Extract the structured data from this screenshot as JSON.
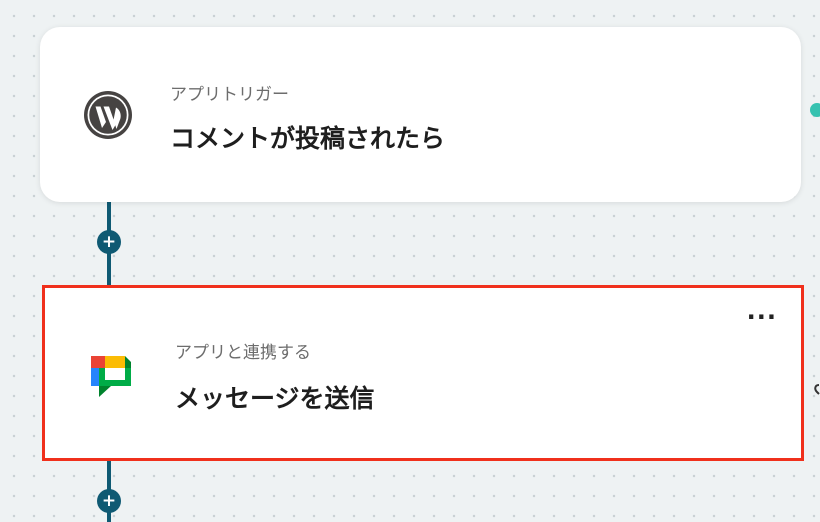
{
  "flow": {
    "steps": [
      {
        "app_icon": "wordpress-icon",
        "subtitle": "アプリトリガー",
        "title": "コメントが投稿されたら"
      },
      {
        "app_icon": "google-chat-icon",
        "subtitle": "アプリと連携する",
        "title": "メッセージを送信",
        "more_label": "···",
        "selected": true
      }
    ],
    "add_step_label": "+"
  },
  "colors": {
    "connector": "#0f5a73",
    "selection_border": "#f0301c",
    "canvas_background": "#eef2f3"
  }
}
